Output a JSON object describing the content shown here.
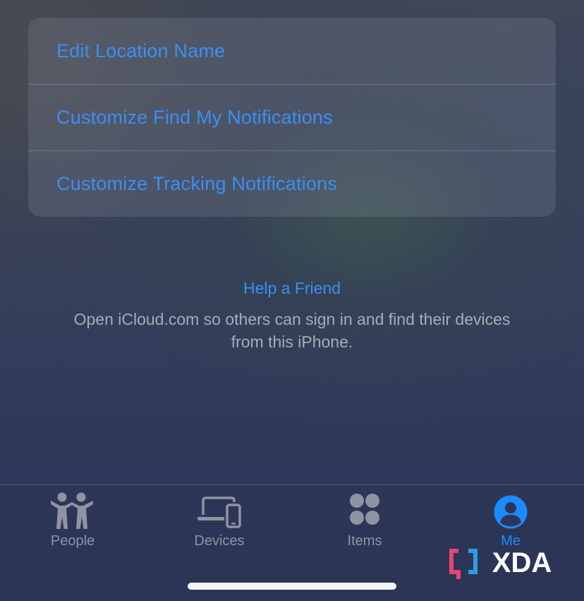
{
  "settings": {
    "items": [
      {
        "label": "Edit Location Name"
      },
      {
        "label": "Customize Find My Notifications"
      },
      {
        "label": "Customize Tracking Notifications"
      }
    ]
  },
  "help": {
    "link": "Help a Friend",
    "description": "Open iCloud.com so others can sign in and find their devices from this iPhone."
  },
  "tabbar": {
    "tabs": [
      {
        "label": "People",
        "icon": "people-icon",
        "active": false
      },
      {
        "label": "Devices",
        "icon": "devices-icon",
        "active": false
      },
      {
        "label": "Items",
        "icon": "items-icon",
        "active": false
      },
      {
        "label": "Me",
        "icon": "person-circle-icon",
        "active": true
      }
    ]
  },
  "watermark": {
    "text": "XDA"
  },
  "colors": {
    "link_blue": "#3b8ff3",
    "active_tab": "#1a8cff",
    "inactive_tab": "#8e94a3",
    "xda_pink": "#e8456f",
    "xda_blue": "#2f9be6"
  }
}
